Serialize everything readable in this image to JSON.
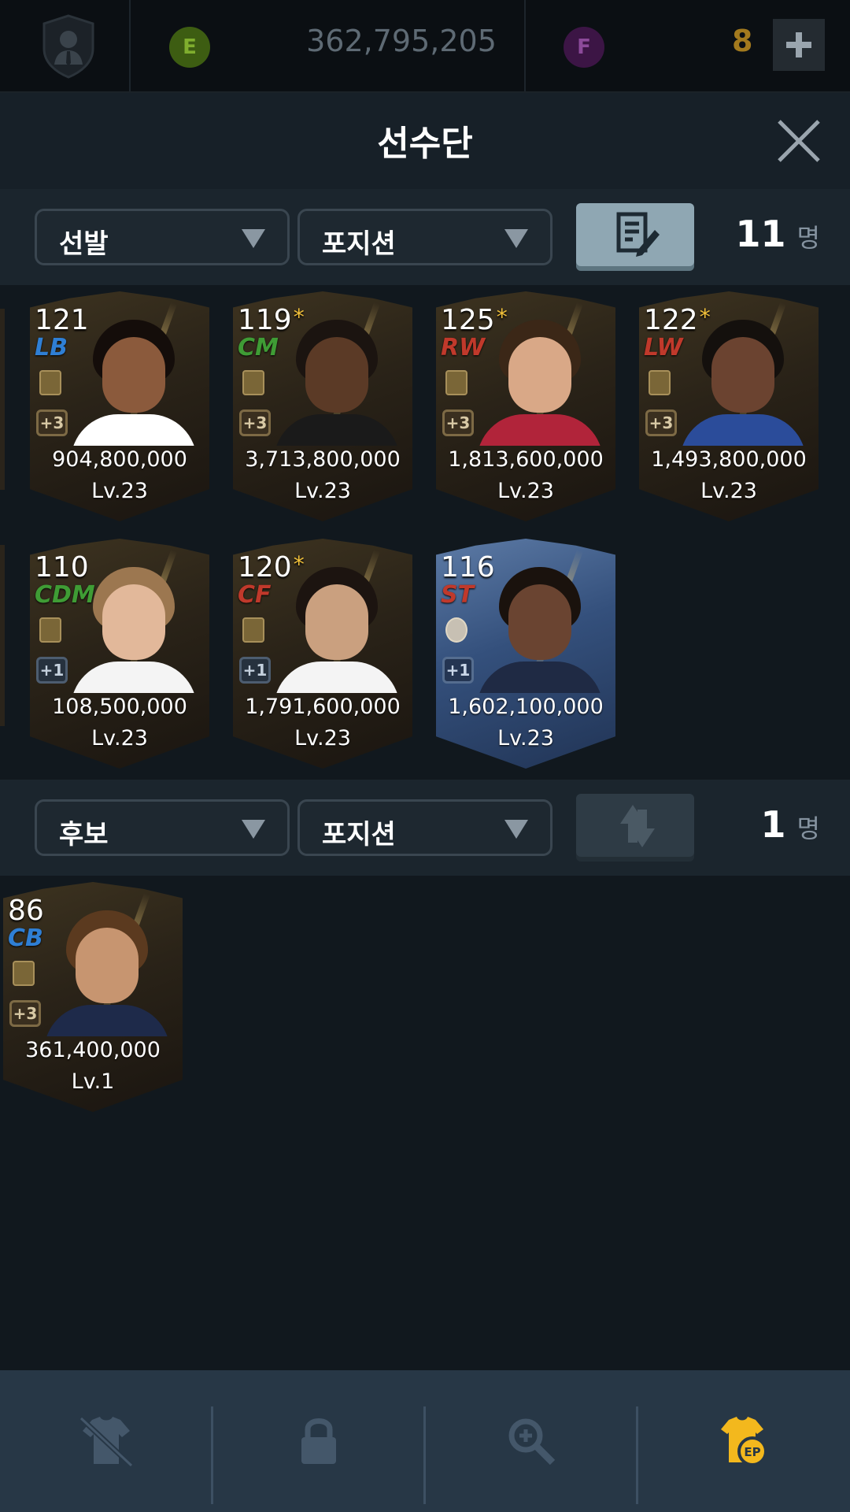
{
  "topbar": {
    "ep_coin_letter": "E",
    "ep_amount": "362,795,205",
    "fc_coin_letter": "F",
    "fc_amount": "8"
  },
  "title": "선수단",
  "starting": {
    "filter_label": "선발",
    "position_filter_label": "포지션",
    "count": "11",
    "count_unit": "명",
    "players": [
      {
        "ovr": "121",
        "star": "",
        "pos": "LB",
        "pos_color": "#2f7fd4",
        "plus": "+3",
        "price": "904,800,000",
        "level": "Lv.23",
        "skin": "#8b5a3c",
        "hair": "#140d0a",
        "shirt": "#ffffff"
      },
      {
        "ovr": "119",
        "star": "*",
        "pos": "CM",
        "pos_color": "#3f9c35",
        "plus": "+3",
        "price": "3,713,800,000",
        "level": "Lv.23",
        "skin": "#5b3a26",
        "hair": "#1b1410",
        "shirt": "#1a1a1a"
      },
      {
        "ovr": "125",
        "star": "*",
        "pos": "RW",
        "pos_color": "#c0392b",
        "plus": "+3",
        "price": "1,813,600,000",
        "level": "Lv.23",
        "skin": "#d9a887",
        "hair": "#3b2717",
        "shirt": "#b1243a"
      },
      {
        "ovr": "122",
        "star": "*",
        "pos": "LW",
        "pos_color": "#c0392b",
        "plus": "+3",
        "price": "1,493,800,000",
        "level": "Lv.23",
        "skin": "#6b4330",
        "hair": "#14100d",
        "shirt": "#2b4c9a"
      },
      {
        "ovr": "110",
        "star": "",
        "pos": "CDM",
        "pos_color": "#3f9c35",
        "plus": "+1",
        "price": "108,500,000",
        "level": "Lv.23",
        "skin": "#e2b89a",
        "hair": "#9c7750",
        "shirt": "#f4f4f4"
      },
      {
        "ovr": "120",
        "star": "*",
        "pos": "CF",
        "pos_color": "#c0392b",
        "plus": "+1",
        "price": "1,791,600,000",
        "level": "Lv.23",
        "skin": "#caa07f",
        "hair": "#1c1410",
        "shirt": "#f4f4f4"
      },
      {
        "ovr": "116",
        "star": "",
        "pos": "ST",
        "pos_color": "#c0392b",
        "plus": "+1",
        "price": "1,602,100,000",
        "level": "Lv.23",
        "skin": "#6a4431",
        "hair": "#1a120d",
        "shirt": "#1f2a44"
      }
    ]
  },
  "substitutes": {
    "filter_label": "후보",
    "position_filter_label": "포지션",
    "count": "1",
    "count_unit": "명",
    "players": [
      {
        "ovr": "86",
        "star": "",
        "pos": "CB",
        "pos_color": "#2f7fd4",
        "plus": "+3",
        "price": "361,400,000",
        "level": "Lv.1",
        "skin": "#c79570",
        "hair": "#5b3a1f",
        "shirt": "#1e2a4a"
      }
    ]
  },
  "bottom_nav": {
    "items": [
      "uniform-off-icon",
      "lock-icon",
      "search-plus-icon",
      "ep-jersey-icon"
    ],
    "active_color": "#f3b81d",
    "inactive_color": "#44576a"
  }
}
